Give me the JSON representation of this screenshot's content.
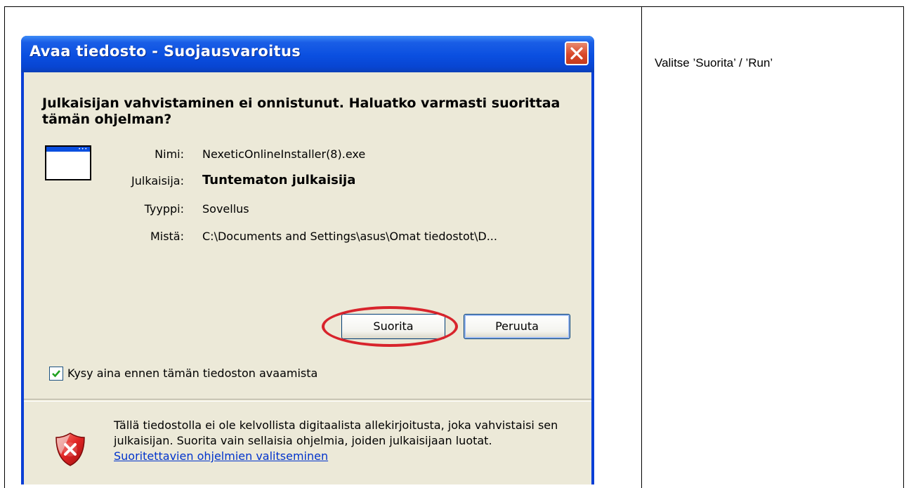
{
  "dialog": {
    "title": "Avaa tiedosto - Suojausvaroitus",
    "heading": "Julkaisijan vahvistaminen ei onnistunut. Haluatko varmasti suorittaa tämän ohjelman?",
    "properties": {
      "name_label": "Nimi:",
      "name_value": "NexeticOnlineInstaller(8).exe",
      "publisher_label": "Julkaisija:",
      "publisher_value": "Tuntematon julkaisija",
      "type_label": "Tyyppi:",
      "type_value": "Sovellus",
      "from_label": "Mistä:",
      "from_value": "C:\\Documents and Settings\\asus\\Omat tiedostot\\D..."
    },
    "buttons": {
      "run": "Suorita",
      "cancel": "Peruuta"
    },
    "checkbox": {
      "label": "Kysy aina ennen tämän tiedoston avaamista",
      "checked": true
    },
    "warning": {
      "text": "Tällä tiedostolla ei ole kelvollista digitaalista allekirjoitusta, joka vahvistaisi sen julkaisijan. Suorita vain sellaisia ohjelmia, joiden julkaisijaan luotat.",
      "link": "Suoritettavien ohjelmien valitseminen"
    },
    "icons": {
      "app": "window-icon",
      "close": "close-icon",
      "warning": "shield-x-icon"
    }
  },
  "note": {
    "text": "Valitse ’Suorita’ / ’Run’"
  },
  "colors": {
    "titlebar": "#0a4fe0",
    "dialog_bg": "#ece9d8",
    "highlight": "#d8242c",
    "link": "#0033cc"
  }
}
